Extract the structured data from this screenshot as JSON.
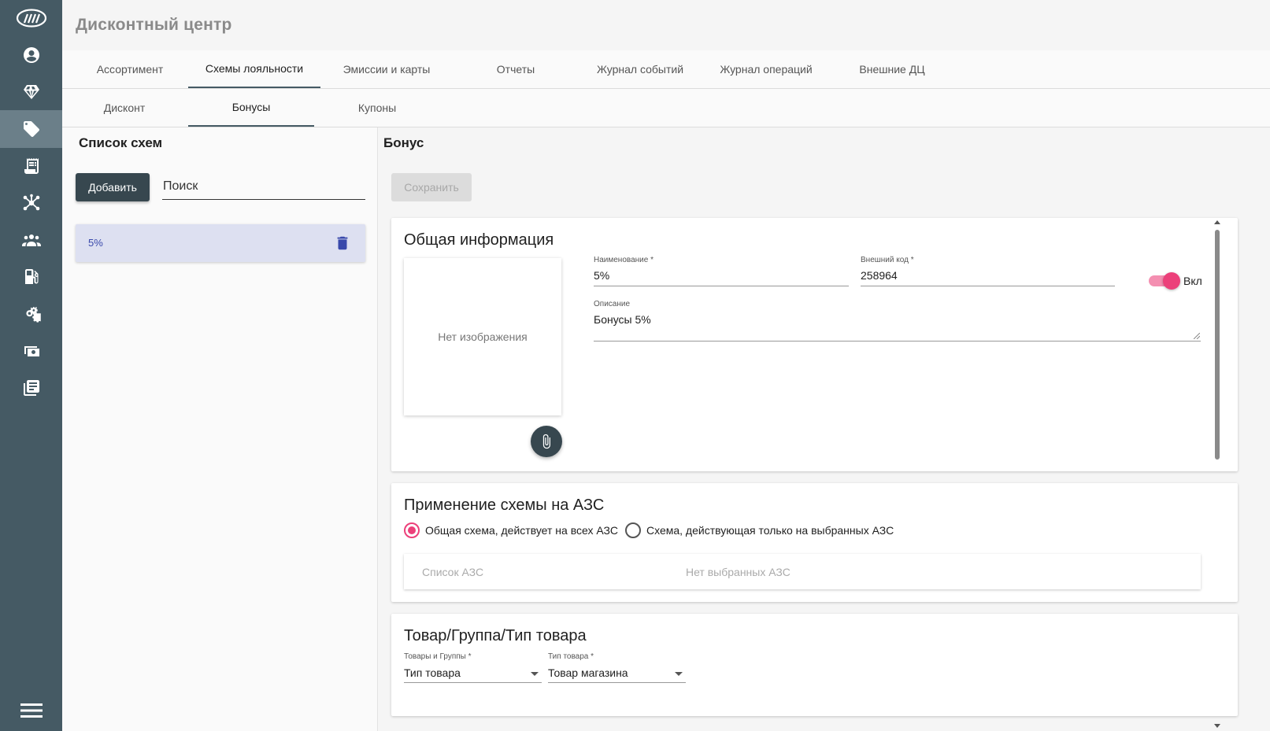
{
  "app": {
    "title": "Дисконтный центр"
  },
  "sidebar": {
    "items": [
      {
        "icon": "account-circle-icon"
      },
      {
        "icon": "diamond-icon"
      },
      {
        "icon": "tag-icon",
        "active": true
      },
      {
        "icon": "receipt-icon"
      },
      {
        "icon": "hub-icon"
      },
      {
        "icon": "users-icon"
      },
      {
        "icon": "fuel-station-icon"
      },
      {
        "icon": "gears-icon"
      },
      {
        "icon": "cash-icon"
      },
      {
        "icon": "journal-icon"
      }
    ],
    "menu_icon": "hamburger-icon"
  },
  "tabs": {
    "main": [
      {
        "label": "Ассортимент"
      },
      {
        "label": "Схемы лояльности",
        "active": true
      },
      {
        "label": "Эмиссии и карты"
      },
      {
        "label": "Отчеты"
      },
      {
        "label": "Журнал событий"
      },
      {
        "label": "Журнал операций"
      },
      {
        "label": "Внешние ДЦ"
      }
    ],
    "sub": [
      {
        "label": "Дисконт"
      },
      {
        "label": "Бонусы",
        "active": true
      },
      {
        "label": "Купоны"
      }
    ]
  },
  "left": {
    "title": "Список схем",
    "add_label": "Добавить",
    "search_placeholder": "Поиск",
    "items": [
      {
        "name": "5%"
      }
    ]
  },
  "right": {
    "title": "Бонус",
    "save_label": "Сохранить",
    "general": {
      "title": "Общая информация",
      "no_image": "Нет изображения",
      "name_label": "Наименование *",
      "name_value": "5%",
      "code_label": "Внешний код *",
      "code_value": "258964",
      "toggle_label": "Вкл",
      "toggle_on": true,
      "desc_label": "Описание",
      "desc_value": "Бонусы 5%"
    },
    "azs": {
      "title": "Применение схемы на АЗС",
      "option_all": "Общая схема, действует на всех АЗС",
      "option_selected": "Схема, действующая только на выбранных АЗС",
      "list_label": "Список АЗС",
      "list_empty": "Нет выбранных АЗС"
    },
    "goods": {
      "title": "Товар/Группа/Тип товара",
      "goods_label": "Товары и Группы *",
      "goods_value": "Тип товара",
      "type_label": "Тип товара *",
      "type_value": "Товар магазина"
    }
  },
  "colors": {
    "sidebar": "#455a64",
    "accent": "#ec407a",
    "dark_button": "#37474f",
    "selected_item": "#dde0f1"
  }
}
